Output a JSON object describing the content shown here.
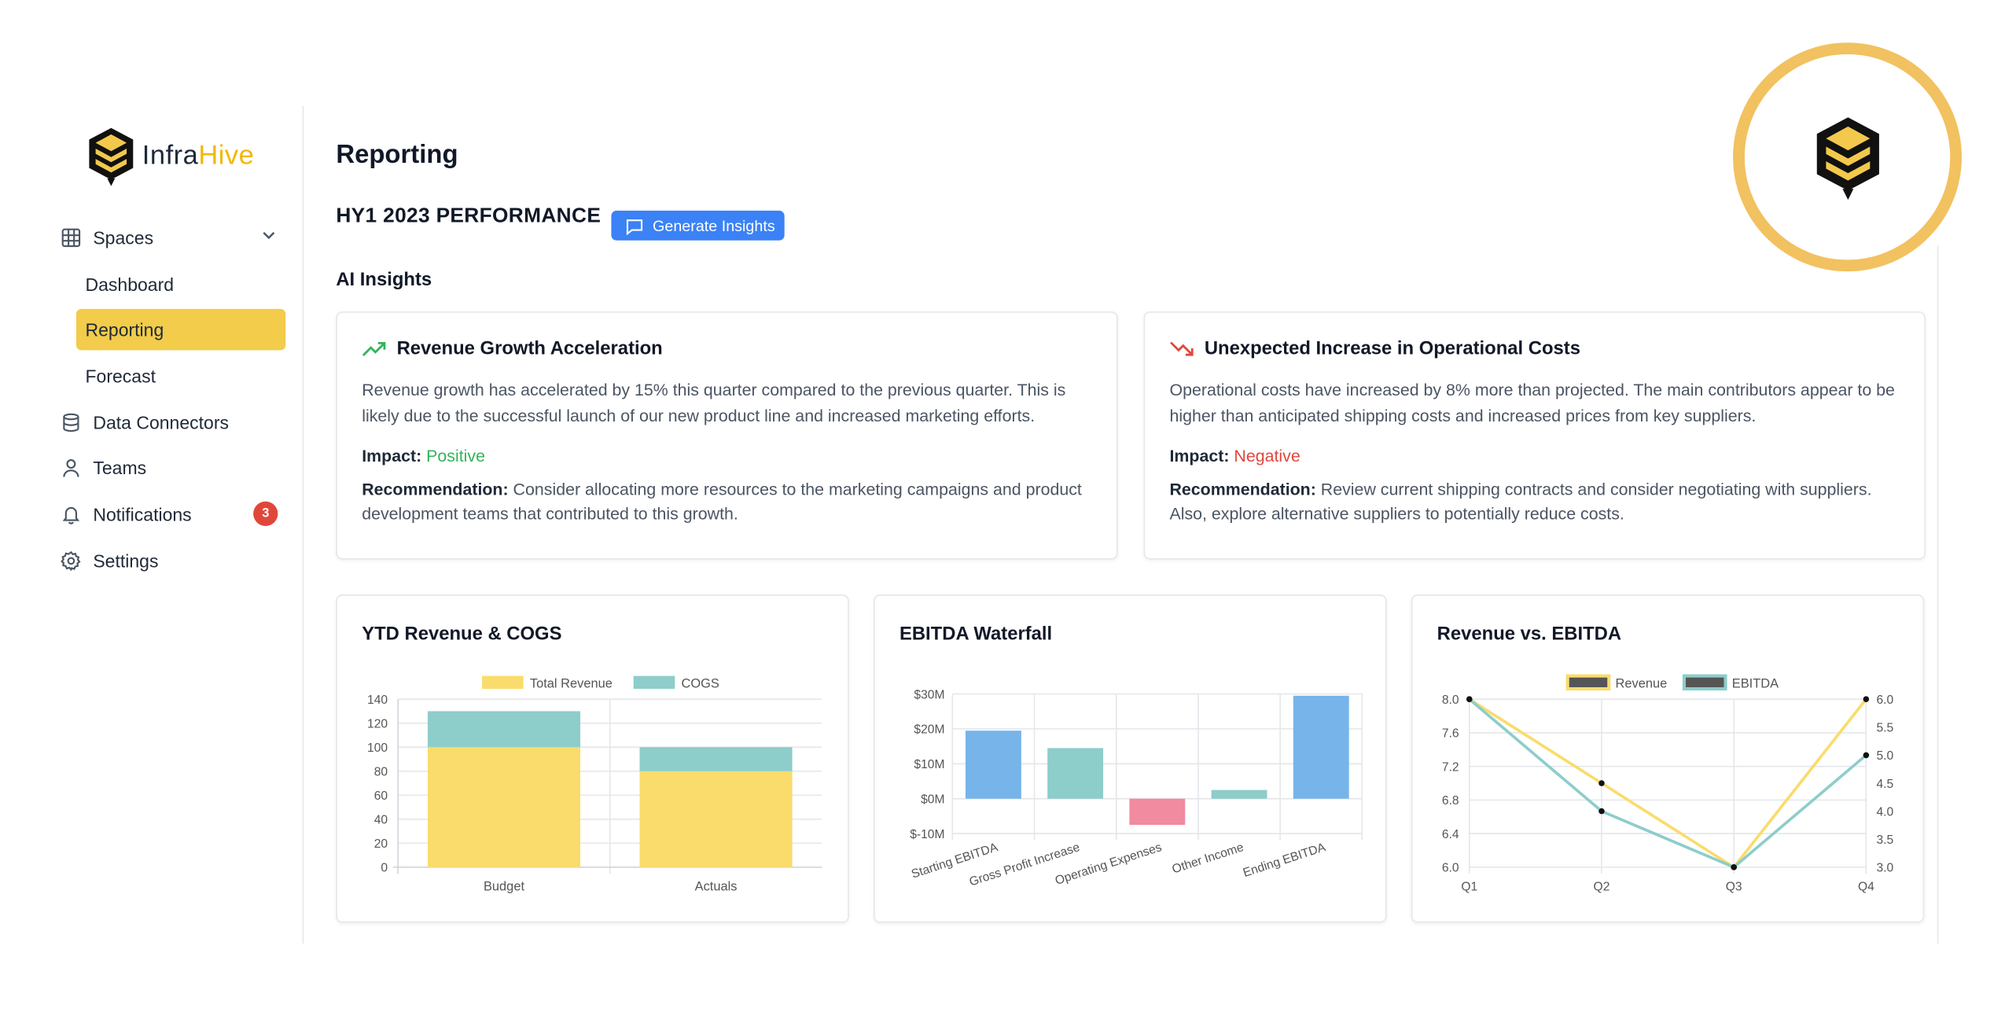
{
  "brand": {
    "name_part1": "Infra",
    "name_part2": "Hive",
    "accent_color": "#f2c94c"
  },
  "sidebar": {
    "spaces": {
      "label": "Spaces",
      "icon": "grid-icon"
    },
    "sub_items": [
      {
        "label": "Dashboard",
        "active": false
      },
      {
        "label": "Reporting",
        "active": true
      },
      {
        "label": "Forecast",
        "active": false
      }
    ],
    "items": [
      {
        "label": "Data Connectors",
        "icon": "database-icon"
      },
      {
        "label": "Teams",
        "icon": "user-icon"
      },
      {
        "label": "Notifications",
        "icon": "bell-icon",
        "badge": "3"
      },
      {
        "label": "Settings",
        "icon": "gear-icon"
      }
    ]
  },
  "header": {
    "title": "Reporting",
    "section_title": "HY1 2023 PERFORMANCE",
    "generate_button": "Generate Insights",
    "ai_insights_label": "AI Insights"
  },
  "insights": [
    {
      "title": "Revenue Growth Acceleration",
      "icon": "trending-up-icon",
      "description": "Revenue growth has accelerated by 15% this quarter compared to the previous quarter. This is likely due to the successful launch of our new product line and increased marketing efforts.",
      "impact_label": "Impact:",
      "impact_value": "Positive",
      "recommendation_label": "Recommendation:",
      "recommendation": "Consider allocating more resources to the marketing campaigns and product development teams that contributed to this growth."
    },
    {
      "title": "Unexpected Increase in Operational Costs",
      "icon": "trending-down-icon",
      "description": "Operational costs have increased by 8% more than projected. The main contributors appear to be higher than anticipated shipping costs and increased prices from key suppliers.",
      "impact_label": "Impact:",
      "impact_value": "Negative",
      "recommendation_label": "Recommendation:",
      "recommendation": "Review current shipping contracts and consider negotiating with suppliers. Also, explore alternative suppliers to potentially reduce costs."
    }
  ],
  "chart_data": [
    {
      "type": "bar",
      "stacked": true,
      "title": "YTD Revenue & COGS",
      "categories": [
        "Budget",
        "Actuals"
      ],
      "series": [
        {
          "name": "Total Revenue",
          "values": [
            100,
            80
          ],
          "color": "#f9dc6b"
        },
        {
          "name": "COGS",
          "values": [
            30,
            20
          ],
          "color": "#8dcdca"
        }
      ],
      "ylim": [
        0,
        140
      ],
      "yticks": [
        0,
        20,
        40,
        60,
        80,
        100,
        120,
        140
      ],
      "grid": true,
      "legend": "top"
    },
    {
      "type": "bar",
      "subtype": "waterfall",
      "title": "EBITDA Waterfall",
      "categories": [
        "Starting EBITDA",
        "Gross Profit Increase",
        "Operating Expenses",
        "Other Income",
        "Ending EBITDA"
      ],
      "values": [
        19.5,
        14.5,
        -7.5,
        2.5,
        29.5
      ],
      "colors": [
        "#76b4ea",
        "#8dcdca",
        "#f08ba0",
        "#8dcdca",
        "#76b4ea"
      ],
      "ylim": [
        -10,
        30
      ],
      "yticks": [
        -10,
        0,
        10,
        20,
        30
      ],
      "ytick_labels": [
        "$-10M",
        "$0M",
        "$10M",
        "$20M",
        "$30M"
      ],
      "grid": true
    },
    {
      "type": "line",
      "title": "Revenue vs. EBITDA",
      "categories": [
        "Q1",
        "Q2",
        "Q3",
        "Q4"
      ],
      "series": [
        {
          "name": "Revenue",
          "axis": "left",
          "values": [
            8.0,
            7.0,
            6.0,
            8.0
          ],
          "color": "#f9dc6b"
        },
        {
          "name": "EBITDA",
          "axis": "right",
          "values": [
            6.0,
            4.0,
            3.0,
            5.0
          ],
          "color": "#8dcdca"
        }
      ],
      "ylim_left": [
        6.0,
        8.0
      ],
      "yticks_left": [
        "6.0",
        "6.4",
        "6.8",
        "7.2",
        "7.6",
        "8.0"
      ],
      "ylim_right": [
        3.0,
        6.0
      ],
      "yticks_right": [
        "3.0",
        "3.5",
        "4.0",
        "4.5",
        "5.0",
        "5.5",
        "6.0"
      ],
      "grid": true,
      "legend": "top"
    }
  ]
}
